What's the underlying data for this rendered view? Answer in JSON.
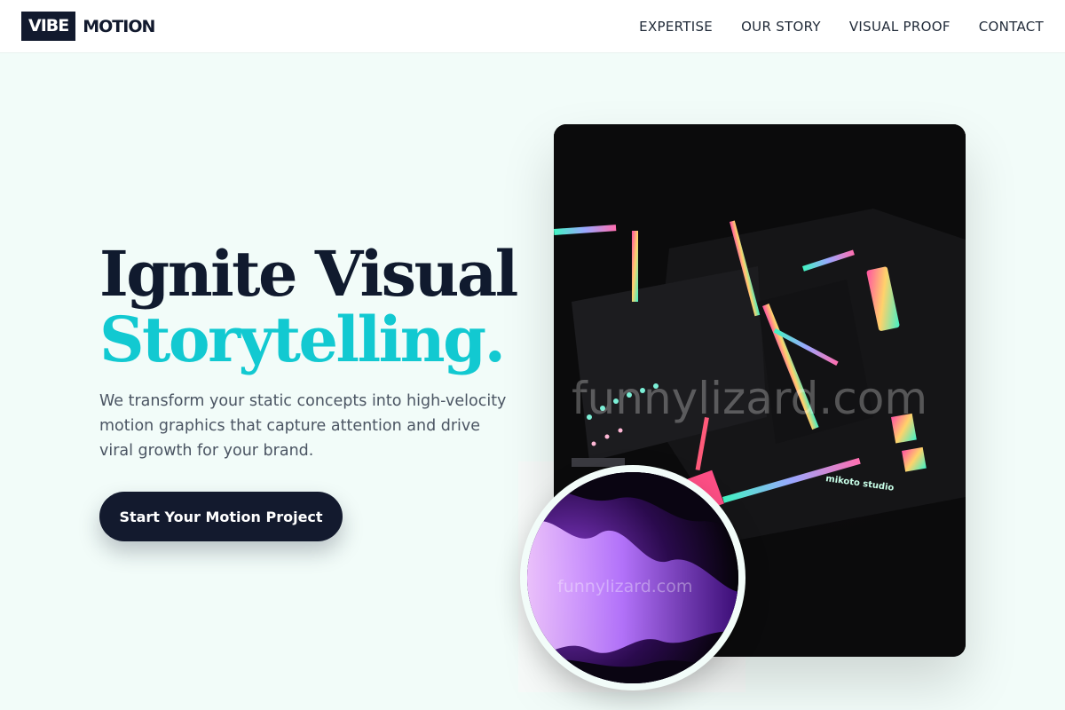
{
  "brand": {
    "logo_box": "VIBE",
    "logo_text": "MOTION"
  },
  "nav": {
    "items": [
      "EXPERTISE",
      "OUR STORY",
      "VISUAL PROOF",
      "CONTACT"
    ]
  },
  "hero": {
    "headline_line1": "Ignite Visual",
    "headline_line2": "Storytelling.",
    "lede": "We transform your static concepts into high-velocity motion graphics that capture attention and drive viral growth for your brand.",
    "cta_label": "Start Your Motion Project"
  },
  "media": {
    "card_watermark": "funnylizard.com",
    "circle_watermark": "funnylizard.com",
    "card_sign_text": "mikoto studio"
  },
  "colors": {
    "navy": "#131a2e",
    "accent": "#12c9d1",
    "page_bg": "#f2fcf9"
  }
}
